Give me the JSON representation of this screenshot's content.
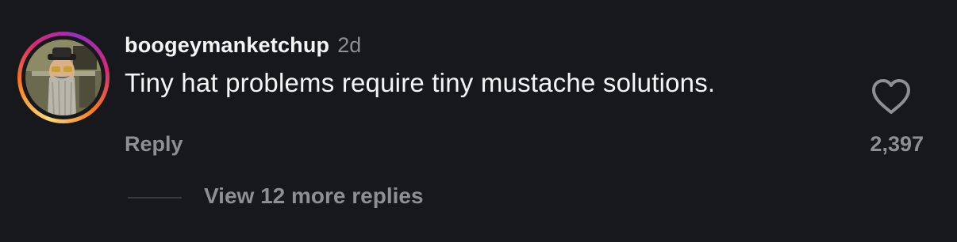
{
  "comment": {
    "username": "boogeymanketchup",
    "timestamp": "2d",
    "text": "Tiny hat problems require tiny mustache solutions.",
    "reply_label": "Reply",
    "like_count": "2,397",
    "view_replies_label": "View 12 more replies",
    "avatar_icon": "profile-photo-avatar",
    "like_icon": "heart-outline-icon"
  },
  "colors": {
    "background": "#17181c",
    "primary_text": "#f5f5f5",
    "secondary_text": "#8e8e93",
    "story_ring": [
      "#feda75",
      "#fa7e1e",
      "#d62976",
      "#962fbf"
    ]
  }
}
